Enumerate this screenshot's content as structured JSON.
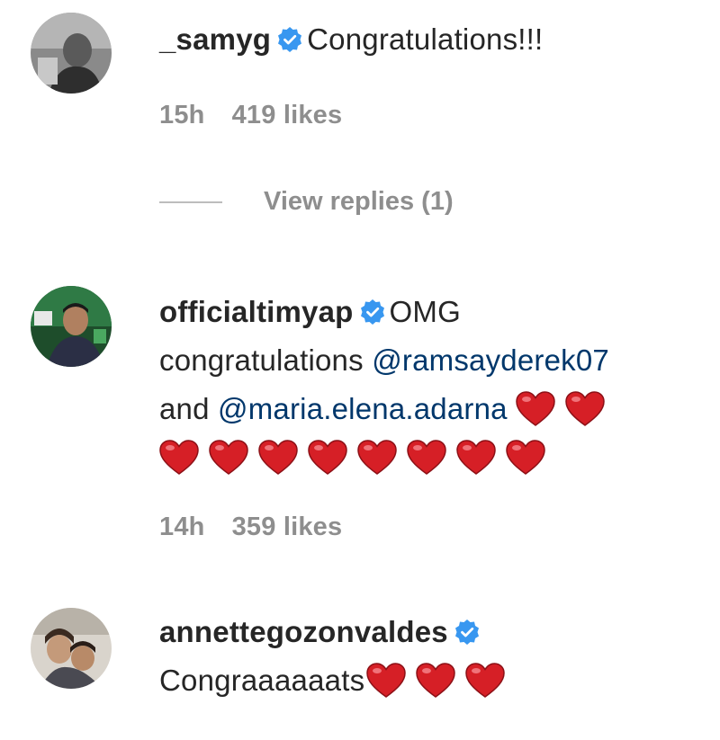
{
  "comments": [
    {
      "username": "_samyg",
      "text": "Congratulations!!!",
      "time": "15h",
      "likes": "419 likes",
      "avatar_icon": "profile-photo"
    },
    {
      "username": "officialtimyap",
      "text_start": "OMG",
      "text_mid": "congratulations",
      "mention1": "@ramsayderek07",
      "text_and": "and",
      "mention2": "@maria.elena.adarna",
      "time": "14h",
      "likes": "359 likes",
      "avatar_icon": "profile-photo"
    },
    {
      "username": "annettegozonvaldes",
      "text": "Congraaaaaats",
      "avatar_icon": "profile-photo"
    }
  ],
  "view_replies": "View replies (1)",
  "colors": {
    "verified": "#3897f0",
    "heart": "#d61f26",
    "meta": "#8e8e8e",
    "mention": "#00376b"
  }
}
